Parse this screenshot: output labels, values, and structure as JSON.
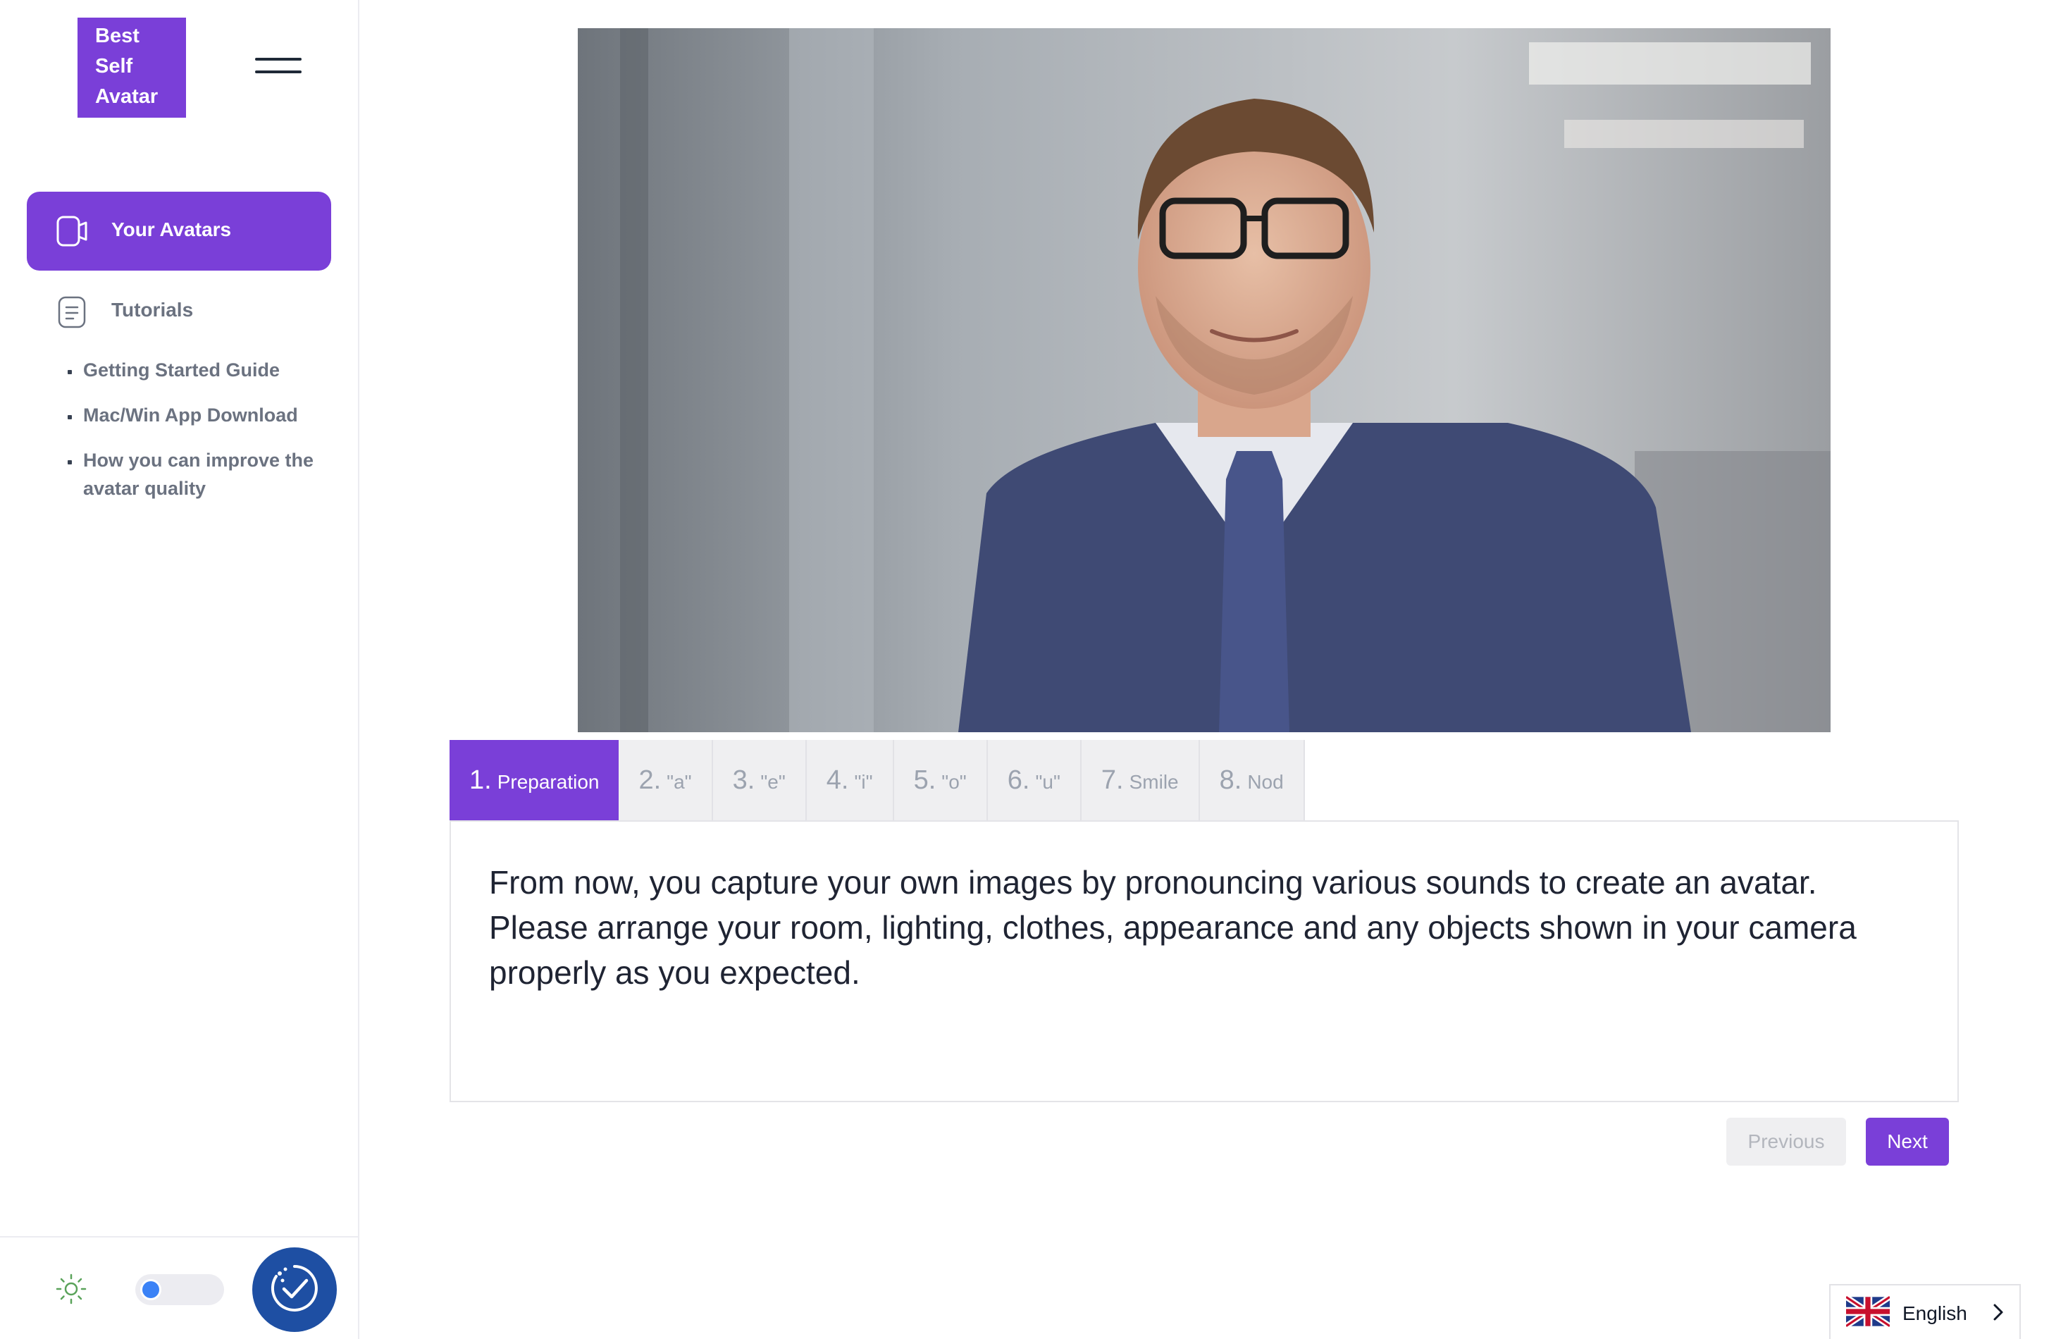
{
  "sidebar": {
    "logo_lines": [
      "Best",
      "Self",
      "Avatar"
    ],
    "nav": [
      {
        "label": "Your Avatars",
        "icon": "camera-icon",
        "active": true
      },
      {
        "label": "Tutorials",
        "icon": "document-icon",
        "active": false
      }
    ],
    "tutorial_links": [
      "Getting Started Guide",
      "Mac/Win App Download",
      "How you can improve the avatar quality"
    ],
    "theme_toggle": {
      "icon": "sun-icon",
      "state": "off"
    },
    "accessibility_icon": "accessibility-check-icon"
  },
  "steps": [
    {
      "num": "1.",
      "label": "Preparation",
      "active": true
    },
    {
      "num": "2.",
      "label": "\"a\"",
      "active": false
    },
    {
      "num": "3.",
      "label": "\"e\"",
      "active": false
    },
    {
      "num": "4.",
      "label": "\"i\"",
      "active": false
    },
    {
      "num": "5.",
      "label": "\"o\"",
      "active": false
    },
    {
      "num": "6.",
      "label": "\"u\"",
      "active": false
    },
    {
      "num": "7.",
      "label": "Smile",
      "active": false
    },
    {
      "num": "8.",
      "label": "Nod",
      "active": false
    }
  ],
  "instructions": "From now, you capture your own images by pronouncing various sounds to create an avatar. Please arrange your room, lighting, clothes, appearance and any objects shown in your camera properly as you expected.",
  "buttons": {
    "previous": "Previous",
    "next": "Next"
  },
  "language": {
    "label": "English",
    "flag": "uk-flag-icon"
  },
  "colors": {
    "accent": "#7a3fd8",
    "accessibility_button": "#1e4fa3",
    "toggle_knob": "#3b82f6"
  }
}
